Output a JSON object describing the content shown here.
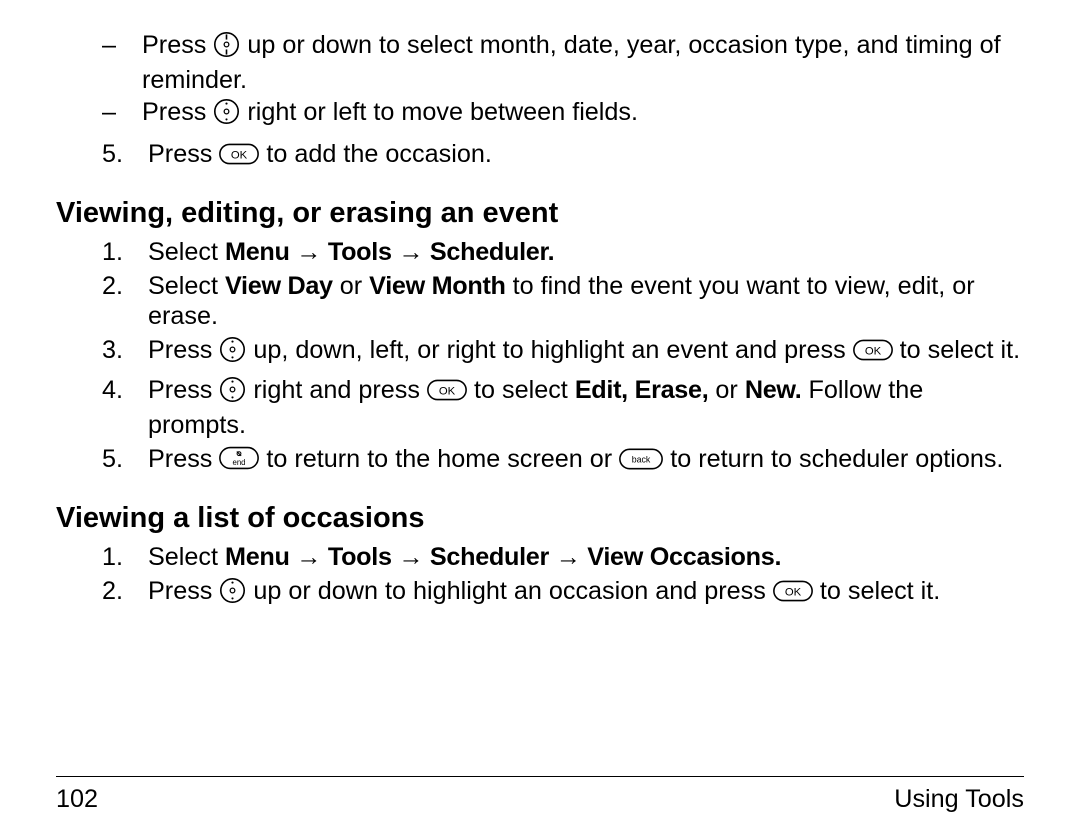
{
  "top_sublist": [
    {
      "pre": "Press ",
      "icon": "nav-updown",
      "post": " up or down to select month, date, year, occasion type, and timing of reminder."
    },
    {
      "pre": "Press ",
      "icon": "nav-center",
      "post": " right or left to move between fields."
    }
  ],
  "top_step5_num": "5.",
  "top_step5_pre": "Press ",
  "top_step5_post": " to add the occasion.",
  "sectionA_heading": "Viewing, editing, or erasing an event",
  "sectionA_steps": [
    {
      "num": "1.",
      "type": "select",
      "pre": "Select ",
      "bold": "Menu → Tools → Scheduler."
    },
    {
      "num": "2.",
      "type": "mixed",
      "parts": "Select <b>View Day</b> or <b>View Month</b> to find the event you want to view, edit, or erase."
    },
    {
      "num": "3.",
      "type": "nav_ok",
      "pre": "Press ",
      "mid": " up, down, left, or right to highlight an event and press ",
      "post": " to select it."
    },
    {
      "num": "4.",
      "type": "nav_ok_bold",
      "pre": "Press ",
      "mid1": " right and press ",
      "mid2": " to select ",
      "bold": "Edit, Erase,",
      "or": " or ",
      "bold2": "New.",
      "tail": " Follow the prompts."
    },
    {
      "num": "5.",
      "type": "end_back",
      "pre": "Press ",
      "mid": " to return to the home screen or ",
      "post": " to return to scheduler options."
    }
  ],
  "sectionB_heading": "Viewing a list of occasions",
  "sectionB_steps": [
    {
      "num": "1.",
      "type": "select",
      "pre": "Select ",
      "bold": "Menu → Tools → Scheduler → View Occasions."
    },
    {
      "num": "2.",
      "type": "nav_ok2",
      "pre": "Press ",
      "mid": " up or down to highlight an occasion and press ",
      "post": " to select it."
    }
  ],
  "footer_left": "102",
  "footer_right": "Using Tools"
}
